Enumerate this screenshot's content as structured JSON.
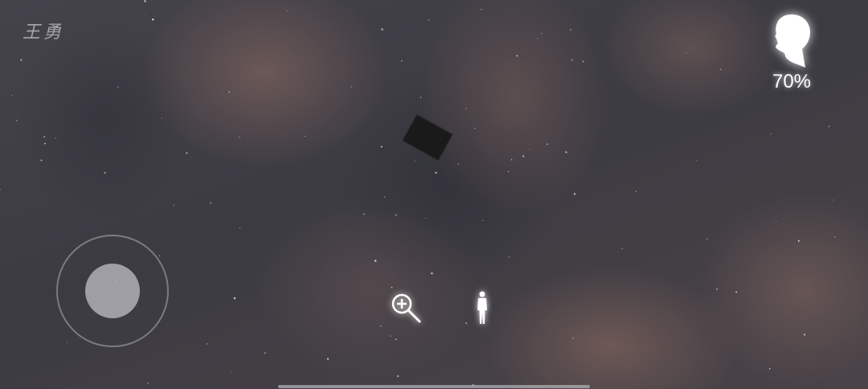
{
  "signature": {
    "text": "王勇"
  },
  "energy": {
    "icon": "head-silhouette-icon",
    "value": "70%",
    "level_percent": 70
  },
  "controls": {
    "joystick": {
      "icon": "joystick-icon"
    },
    "zoom": {
      "icon": "zoom-in-icon"
    },
    "stand": {
      "icon": "standing-person-icon"
    }
  },
  "colors": {
    "glow": "#ffffff",
    "ui_gray": "#aaaaaf",
    "object": "#1b1a1a"
  }
}
